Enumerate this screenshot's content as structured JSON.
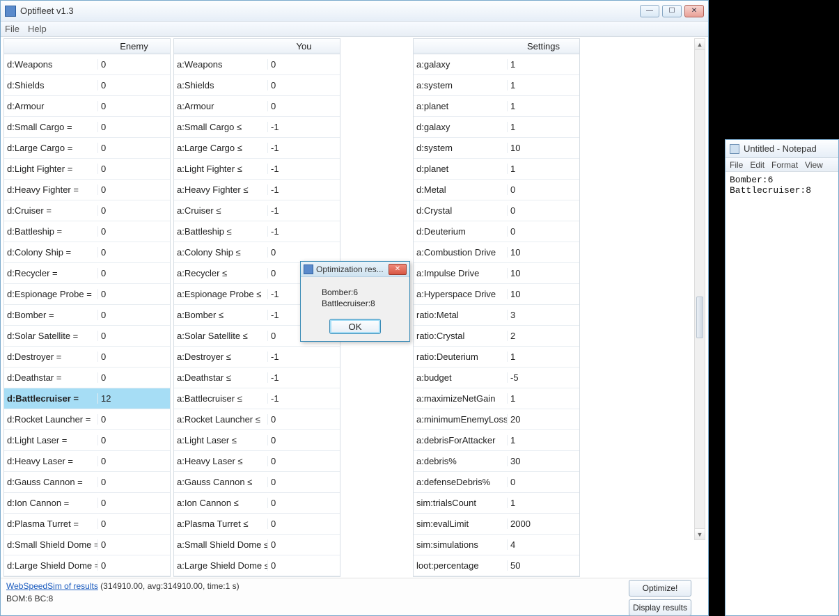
{
  "app": {
    "title": "Optifleet v1.3",
    "menu": {
      "file": "File",
      "help": "Help"
    }
  },
  "headers": {
    "enemy": "Enemy",
    "you": "You",
    "settings": "Settings"
  },
  "enemy": [
    {
      "name": "d:Weapons",
      "val": "0"
    },
    {
      "name": "d:Shields",
      "val": "0"
    },
    {
      "name": "d:Armour",
      "val": "0"
    },
    {
      "name": "d:Small Cargo =",
      "val": "0"
    },
    {
      "name": "d:Large Cargo =",
      "val": "0"
    },
    {
      "name": "d:Light Fighter =",
      "val": "0"
    },
    {
      "name": "d:Heavy Fighter =",
      "val": "0"
    },
    {
      "name": "d:Cruiser =",
      "val": "0"
    },
    {
      "name": "d:Battleship =",
      "val": "0"
    },
    {
      "name": "d:Colony Ship =",
      "val": "0"
    },
    {
      "name": "d:Recycler =",
      "val": "0"
    },
    {
      "name": "d:Espionage Probe =",
      "val": "0"
    },
    {
      "name": "d:Bomber =",
      "val": "0"
    },
    {
      "name": "d:Solar Satellite =",
      "val": "0"
    },
    {
      "name": "d:Destroyer =",
      "val": "0"
    },
    {
      "name": "d:Deathstar =",
      "val": "0"
    },
    {
      "name": "d:Battlecruiser =",
      "val": "12",
      "selected": true
    },
    {
      "name": "d:Rocket Launcher =",
      "val": "0"
    },
    {
      "name": "d:Light Laser =",
      "val": "0"
    },
    {
      "name": "d:Heavy Laser =",
      "val": "0"
    },
    {
      "name": "d:Gauss Cannon =",
      "val": "0"
    },
    {
      "name": "d:Ion Cannon =",
      "val": "0"
    },
    {
      "name": "d:Plasma Turret =",
      "val": "0"
    },
    {
      "name": "d:Small Shield Dome =",
      "val": "0"
    },
    {
      "name": "d:Large Shield Dome =",
      "val": "0"
    }
  ],
  "you": [
    {
      "name": "a:Weapons",
      "val": "0"
    },
    {
      "name": "a:Shields",
      "val": "0"
    },
    {
      "name": "a:Armour",
      "val": "0"
    },
    {
      "name": "a:Small Cargo ≤",
      "val": "-1"
    },
    {
      "name": "a:Large Cargo ≤",
      "val": "-1"
    },
    {
      "name": "a:Light Fighter ≤",
      "val": "-1"
    },
    {
      "name": "a:Heavy Fighter ≤",
      "val": "-1"
    },
    {
      "name": "a:Cruiser ≤",
      "val": "-1"
    },
    {
      "name": "a:Battleship ≤",
      "val": "-1"
    },
    {
      "name": "a:Colony Ship ≤",
      "val": "0"
    },
    {
      "name": "a:Recycler ≤",
      "val": "0"
    },
    {
      "name": "a:Espionage Probe ≤",
      "val": "-1"
    },
    {
      "name": "a:Bomber ≤",
      "val": "-1"
    },
    {
      "name": "a:Solar Satellite ≤",
      "val": "0"
    },
    {
      "name": "a:Destroyer ≤",
      "val": "-1"
    },
    {
      "name": "a:Deathstar ≤",
      "val": "-1"
    },
    {
      "name": "a:Battlecruiser ≤",
      "val": "-1"
    },
    {
      "name": "a:Rocket Launcher ≤",
      "val": "0"
    },
    {
      "name": "a:Light Laser ≤",
      "val": "0"
    },
    {
      "name": "a:Heavy Laser ≤",
      "val": "0"
    },
    {
      "name": "a:Gauss Cannon ≤",
      "val": "0"
    },
    {
      "name": "a:Ion Cannon ≤",
      "val": "0"
    },
    {
      "name": "a:Plasma Turret ≤",
      "val": "0"
    },
    {
      "name": "a:Small Shield Dome ≤",
      "val": "0"
    },
    {
      "name": "a:Large Shield Dome ≤",
      "val": "0"
    }
  ],
  "settings": [
    {
      "name": "a:galaxy",
      "val": "1"
    },
    {
      "name": "a:system",
      "val": "1"
    },
    {
      "name": "a:planet",
      "val": "1"
    },
    {
      "name": "d:galaxy",
      "val": "1"
    },
    {
      "name": "d:system",
      "val": "10"
    },
    {
      "name": "d:planet",
      "val": "1"
    },
    {
      "name": "d:Metal",
      "val": "0"
    },
    {
      "name": "d:Crystal",
      "val": "0"
    },
    {
      "name": "d:Deuterium",
      "val": "0"
    },
    {
      "name": "a:Combustion Drive",
      "val": "10"
    },
    {
      "name": "a:Impulse Drive",
      "val": "10"
    },
    {
      "name": "a:Hyperspace Drive",
      "val": "10"
    },
    {
      "name": "ratio:Metal",
      "val": "3"
    },
    {
      "name": "ratio:Crystal",
      "val": "2"
    },
    {
      "name": "ratio:Deuterium",
      "val": "1"
    },
    {
      "name": "a:budget",
      "val": "-5"
    },
    {
      "name": "a:maximizeNetGain",
      "val": "1"
    },
    {
      "name": "a:minimumEnemyLoss%",
      "val": "20"
    },
    {
      "name": "a:debrisForAttacker",
      "val": "1"
    },
    {
      "name": "a:debris%",
      "val": "30"
    },
    {
      "name": "a:defenseDebris%",
      "val": "0"
    },
    {
      "name": "sim:trialsCount",
      "val": "1"
    },
    {
      "name": "sim:evalLimit",
      "val": "2000"
    },
    {
      "name": "sim:simulations",
      "val": "4"
    },
    {
      "name": "loot:percentage",
      "val": "50"
    }
  ],
  "dialog": {
    "title": "Optimization res...",
    "body": "Bomber:6\nBattlecruiser:8",
    "ok": "OK"
  },
  "footer": {
    "link": "WebSpeedSim of results",
    "stats": " (314910.00, avg:314910.00, time:1 s)",
    "line2": "BOM:6 BC:8",
    "optimize": "Optimize!",
    "display": "Display results"
  },
  "notepad": {
    "title": "Untitled - Notepad",
    "menu": {
      "file": "File",
      "edit": "Edit",
      "format": "Format",
      "view": "View"
    },
    "body": "Bomber:6\nBattlecruiser:8"
  }
}
